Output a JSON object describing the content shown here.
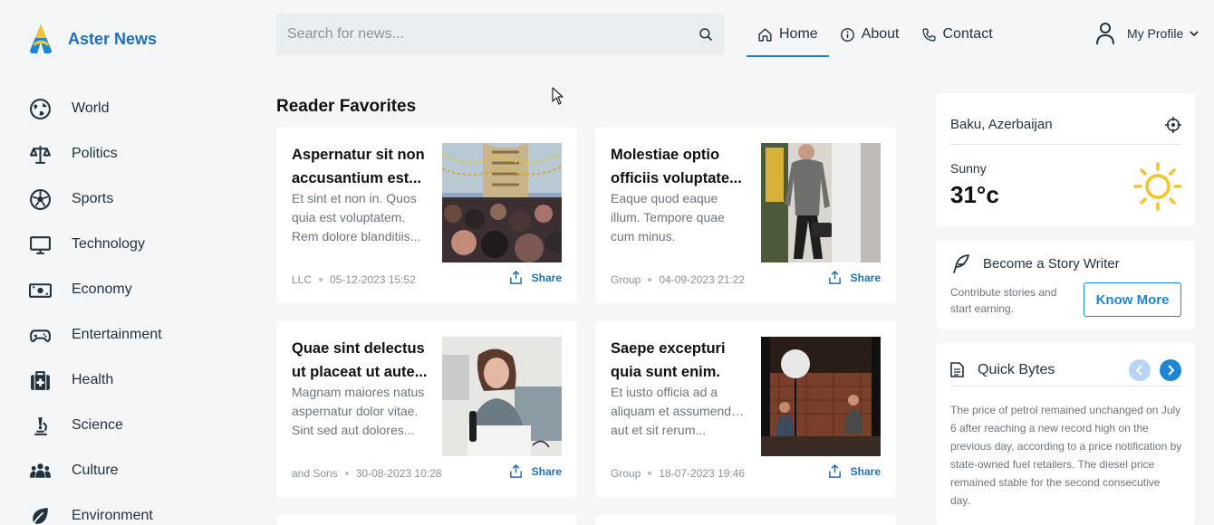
{
  "brand": {
    "name": "Aster News",
    "color": "#1d6fb8"
  },
  "sidebar": {
    "items": [
      {
        "label": "World",
        "icon": "globe-icon"
      },
      {
        "label": "Politics",
        "icon": "scale-icon"
      },
      {
        "label": "Sports",
        "icon": "soccer-ball-icon"
      },
      {
        "label": "Technology",
        "icon": "monitor-icon"
      },
      {
        "label": "Economy",
        "icon": "banknote-icon"
      },
      {
        "label": "Entertainment",
        "icon": "gamepad-icon"
      },
      {
        "label": "Health",
        "icon": "medical-kit-icon"
      },
      {
        "label": "Science",
        "icon": "microscope-icon"
      },
      {
        "label": "Culture",
        "icon": "people-icon"
      },
      {
        "label": "Environment",
        "icon": "leaf-icon"
      }
    ]
  },
  "search": {
    "placeholder": "Search for news...",
    "value": ""
  },
  "topnav": {
    "tabs": [
      {
        "label": "Home",
        "icon": "home-icon",
        "active": true
      },
      {
        "label": "About",
        "icon": "info-icon",
        "active": false
      },
      {
        "label": "Contact",
        "icon": "phone-icon",
        "active": false
      }
    ],
    "profile_label": "My Profile"
  },
  "main": {
    "section_title": "Reader Favorites",
    "articles": [
      {
        "title_line1": "Aspernatur sit non",
        "title_line2": "accusantium est...",
        "desc_line1": "Et sint et non in. Quos",
        "desc_line2": "quia est voluptatem.",
        "desc_line3": "Rem dolore blanditiis...",
        "source": "LLC",
        "date": "05-12-2023 15:52",
        "share_label": "Share",
        "image": "street-crowd-photo"
      },
      {
        "title_line1": "Molestiae optio",
        "title_line2": "officiis voluptate...",
        "desc_line1": "Eaque quod eaque",
        "desc_line2": "illum. Tempore quae",
        "desc_line3": "cum minus.",
        "source": "Group",
        "date": "04-09-2023 21:22",
        "share_label": "Share",
        "image": "man-walking-photo"
      },
      {
        "title_line1": "Quae sint delectus",
        "title_line2": "ut placeat ut aute...",
        "desc_line1": "Magnam maiores natus",
        "desc_line2": "aspernatur dolor vitae.",
        "desc_line3": "Sint sed aut dolores...",
        "source": "and Sons",
        "date": "30-08-2023 10:28",
        "share_label": "Share",
        "image": "woman-podcast-photo"
      },
      {
        "title_line1": "Saepe excepturi",
        "title_line2": "quia sunt enim.",
        "desc_line1": "Et iusto officia ad a",
        "desc_line2": "aliquam et assumenda. Sed",
        "desc_line3": "aut et sit rerum...",
        "source": "Group",
        "date": "18-07-2023 19:46",
        "share_label": "Share",
        "image": "interview-studio-photo"
      }
    ]
  },
  "weather": {
    "location": "Baku, Azerbaijan",
    "condition": "Sunny",
    "temperature": "31°c"
  },
  "writer": {
    "title": "Become a Story Writer",
    "desc_line1": "Contribute stories and",
    "desc_line2": "start earning.",
    "button": "Know More"
  },
  "quick_bytes": {
    "title": "Quick Bytes",
    "text": "The price of petrol remained unchanged on July 6 after reaching a new record high on the previous day, according to a price notification by state-owned fuel retailers. The diesel price remained stable for the second consecutive day."
  },
  "colors": {
    "accent": "#1d85d6",
    "background": "#f4f6f7",
    "sun": "#f6c32b"
  }
}
